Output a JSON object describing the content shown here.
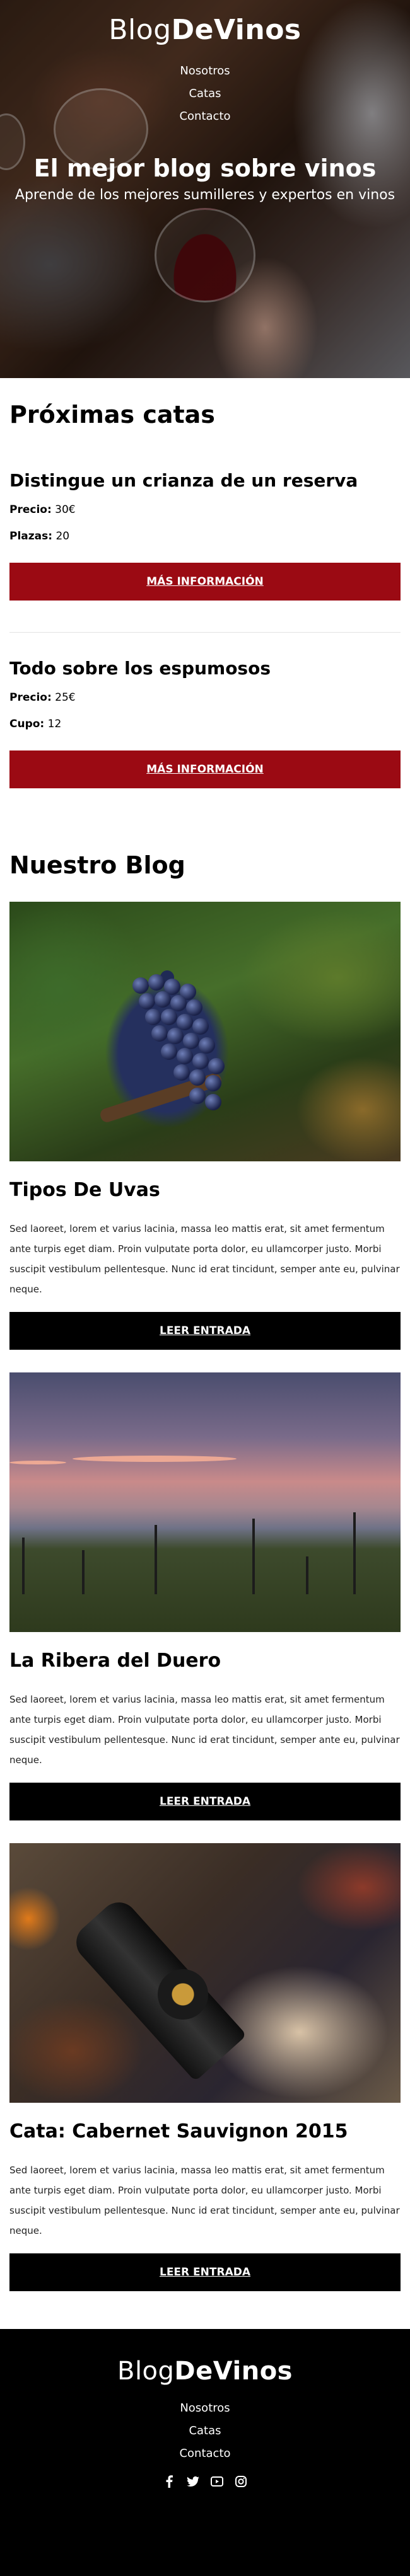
{
  "header": {
    "logo_light": "Blog",
    "logo_bold": "DeVinos",
    "nav": [
      "Nosotros",
      "Catas",
      "Contacto"
    ],
    "title": "El mejor blog sobre vinos",
    "subtitle": "Aprende de los mejores sumilleres y expertos en vinos"
  },
  "catas": {
    "title": "Próximas catas",
    "items": [
      {
        "title": "Distingue un crianza de un reserva",
        "line1_label": "Precio:",
        "line1_value": " 30€",
        "line2_label": "Plazas:",
        "line2_value": " 20",
        "button": "Más información"
      },
      {
        "title": "Todo sobre los espumosos",
        "line1_label": "Precio:",
        "line1_value": " 25€",
        "line2_label": "Cupo:",
        "line2_value": " 12",
        "button": "Más información"
      }
    ]
  },
  "blog": {
    "title": "Nuestro Blog",
    "entries": [
      {
        "title": "Tipos De Uvas",
        "text": "Sed laoreet, lorem et varius lacinia, massa leo mattis erat, sit amet fermentum ante turpis eget diam. Proin vulputate porta dolor, eu ullamcorper justo. Morbi suscipit vestibulum pellentesque. Nunc id erat tincidunt, semper ante eu, pulvinar neque.",
        "button": "Leer entrada"
      },
      {
        "title": "La Ribera del Duero",
        "text": "Sed laoreet, lorem et varius lacinia, massa leo mattis erat, sit amet fermentum ante turpis eget diam. Proin vulputate porta dolor, eu ullamcorper justo. Morbi suscipit vestibulum pellentesque. Nunc id erat tincidunt, semper ante eu, pulvinar neque.",
        "button": "Leer entrada"
      },
      {
        "title": "Cata: Cabernet Sauvignon 2015",
        "text": "Sed laoreet, lorem et varius lacinia, massa leo mattis erat, sit amet fermentum ante turpis eget diam. Proin vulputate porta dolor, eu ullamcorper justo. Morbi suscipit vestibulum pellentesque. Nunc id erat tincidunt, semper ante eu, pulvinar neque.",
        "button": "Leer entrada"
      }
    ]
  },
  "footer": {
    "logo_light": "Blog",
    "logo_bold": "DeVinos",
    "nav": [
      "Nosotros",
      "Catas",
      "Contacto"
    ],
    "social": [
      "facebook-icon",
      "twitter-icon",
      "youtube-icon",
      "instagram-icon"
    ]
  },
  "colors": {
    "accent": "#9b0a13",
    "dark": "#000000"
  }
}
